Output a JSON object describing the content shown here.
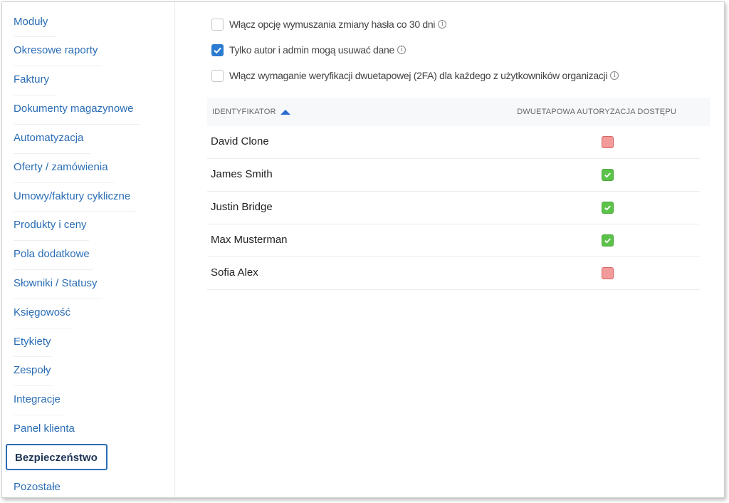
{
  "sidebar": {
    "items": [
      {
        "label": "Moduły"
      },
      {
        "label": "Okresowe raporty"
      },
      {
        "label": "Faktury"
      },
      {
        "label": "Dokumenty magazynowe"
      },
      {
        "label": "Automatyzacja"
      },
      {
        "label": "Oferty / zamówienia"
      },
      {
        "label": "Umowy/faktury cykliczne"
      },
      {
        "label": "Produkty i ceny"
      },
      {
        "label": "Pola dodatkowe"
      },
      {
        "label": "Słowniki / Statusy"
      },
      {
        "label": "Księgowość"
      },
      {
        "label": "Etykiety"
      },
      {
        "label": "Zespoły"
      },
      {
        "label": "Integracje"
      },
      {
        "label": "Panel klienta"
      },
      {
        "label": "Bezpieczeństwo",
        "active": true
      },
      {
        "label": "Pozostałe"
      }
    ]
  },
  "options": [
    {
      "label": "Włącz opcję wymuszania zmiany hasła co 30 dni",
      "checked": false,
      "icon": "info-icon"
    },
    {
      "label": "Tylko autor i admin mogą usuwać dane",
      "checked": true,
      "icon": "info-icon"
    },
    {
      "label": "Włącz wymaganie weryfikacji dwuetapowej (2FA) dla każdego z użytkowników organizacji",
      "checked": false,
      "icon": "info-icon"
    }
  ],
  "table": {
    "headers": {
      "identifier": "IDENTYFIKATOR",
      "two_factor": "DWUETAPOWA AUTORYZACJA DOSTĘPU"
    },
    "rows": [
      {
        "name": "David Clone",
        "two_factor": false
      },
      {
        "name": "James Smith",
        "two_factor": true
      },
      {
        "name": "Justin Bridge",
        "two_factor": true
      },
      {
        "name": "Max Musterman",
        "two_factor": true
      },
      {
        "name": "Sofia Alex",
        "two_factor": false
      }
    ]
  },
  "colors": {
    "link": "#2a6db5",
    "active_border": "#2b6cb5",
    "checkbox_checked": "#2b7bd0",
    "status_on": "#5cc24a",
    "status_off": "#f39a9a"
  }
}
